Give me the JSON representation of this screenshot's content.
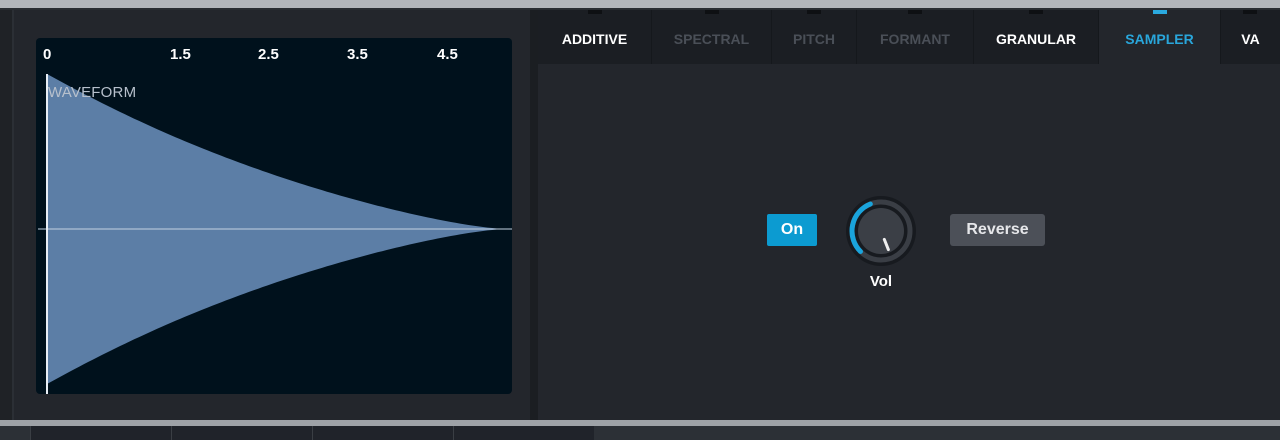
{
  "waveform": {
    "title": "WAVEFORM",
    "ruler_ticks": [
      "0",
      "1.5",
      "2.5",
      "3.5",
      "4.5"
    ],
    "colors": {
      "background": "#00111c",
      "fill": "#5c7ea6",
      "line": "#c4d2e2"
    }
  },
  "tabs": [
    {
      "label": "ADDITIVE",
      "state": "enabled"
    },
    {
      "label": "SPECTRAL",
      "state": "disabled"
    },
    {
      "label": "PITCH",
      "state": "disabled"
    },
    {
      "label": "FORMANT",
      "state": "disabled"
    },
    {
      "label": "GRANULAR",
      "state": "enabled"
    },
    {
      "label": "SAMPLER",
      "state": "selected"
    },
    {
      "label": "VA",
      "state": "enabled"
    }
  ],
  "sampler": {
    "on_label": "On",
    "reverse_label": "Reverse",
    "vol_label": "Vol",
    "vol_level": 0.42
  },
  "colors": {
    "accent": "#29a6db",
    "panel": "#23262c",
    "button_gray": "#4c5058"
  }
}
